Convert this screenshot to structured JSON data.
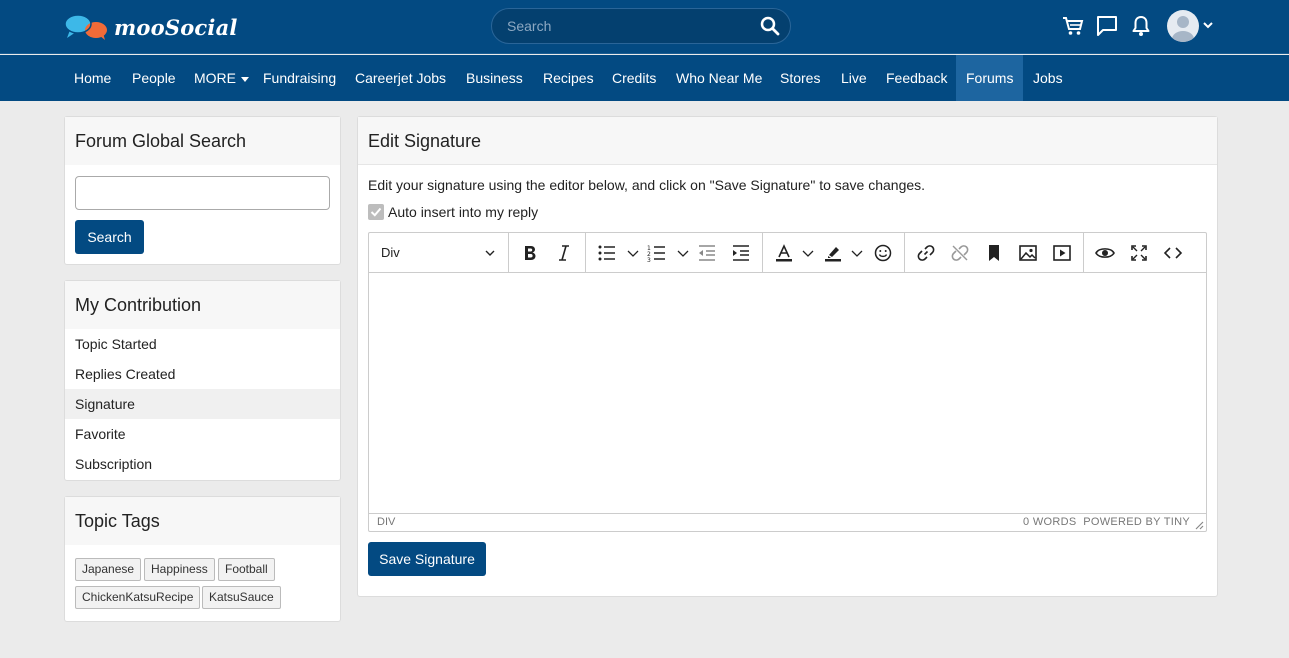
{
  "header": {
    "brand": "mooSocial",
    "search_placeholder": "Search"
  },
  "nav": {
    "items": [
      {
        "label": "Home"
      },
      {
        "label": "People"
      },
      {
        "label": "MORE"
      },
      {
        "label": "Fundraising"
      },
      {
        "label": "Careerjet Jobs"
      },
      {
        "label": "Business"
      },
      {
        "label": "Recipes"
      },
      {
        "label": "Credits"
      },
      {
        "label": "Who Near Me"
      },
      {
        "label": "Stores"
      },
      {
        "label": "Live"
      },
      {
        "label": "Feedback"
      },
      {
        "label": "Forums"
      },
      {
        "label": "Jobs"
      }
    ],
    "active": "Forums"
  },
  "sidebar": {
    "search": {
      "title": "Forum Global Search",
      "button": "Search",
      "value": ""
    },
    "contribution": {
      "title": "My Contribution",
      "items": [
        "Topic Started",
        "Replies Created",
        "Signature",
        "Favorite",
        "Subscription"
      ],
      "active": "Signature"
    },
    "tags": {
      "title": "Topic Tags",
      "items": [
        "Japanese",
        "Happiness",
        "Football",
        "ChickenKatsuRecipe",
        "KatsuSauce"
      ]
    }
  },
  "main": {
    "title": "Edit Signature",
    "instructions": "Edit your signature using the editor below, and click on \"Save Signature\" to save changes.",
    "auto_insert_label": "Auto insert into my reply",
    "auto_insert_checked": true,
    "editor": {
      "block_format": "Div",
      "status_path": "DIV",
      "word_count": "0 WORDS",
      "powered_by": "POWERED BY TINY",
      "content": ""
    },
    "save_button": "Save Signature"
  },
  "colors": {
    "brand_blue": "#034a82",
    "nav_active": "#1d65a0",
    "page_bg": "#ebebeb"
  }
}
